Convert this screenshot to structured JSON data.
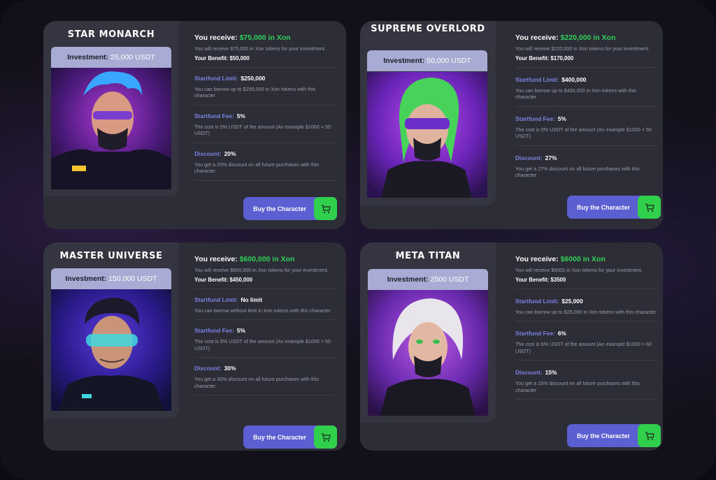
{
  "colors": {
    "accent_green": "#31d158",
    "label_purple": "#7b82df",
    "button_blue": "#5b5fd2",
    "invest_bg": "#a8acd4"
  },
  "common": {
    "receive_label": "You receive:",
    "benefit_label": "Your Benefit:",
    "limit_label": "Startfund Limit:",
    "fee_label": "Startfund Fee:",
    "discount_label": "Discount:",
    "invest_label": "Investment:",
    "buy_label": "Buy the Character",
    "buy_icon": "cart-icon"
  },
  "cards": [
    {
      "name": "STAR MONARCH",
      "investment": "25,000 USDT",
      "receive": "$75,000 in Xon",
      "receive_desc": "You will receive $75,000 in Xon tokens for your investment.",
      "benefit": "$50,000",
      "limit": "$250,000",
      "limit_desc": "You can borrow up to $250,000 in Xon tokens with this character",
      "fee": "5%",
      "fee_desc": "The cost is 5% USDT of the amount (An example $1000 = 50 USDT)",
      "discount": "20%",
      "discount_desc": "You get a 20% discount on all future purchases with this character"
    },
    {
      "name": "SUPREME OVERLORD",
      "investment": "50,000 USDT",
      "receive": "$220,000 in Xon",
      "receive_desc": "You will receive $220,000 in Xon tokens for your investment.",
      "benefit": "$170,000",
      "limit": "$400,000",
      "limit_desc": "You can borrow up to $400,000 in Xon tokens with this character",
      "fee": "5%",
      "fee_desc": "The cost is 5% USDT of the amount (An example $1000 = 50 USDT)",
      "discount": "27%",
      "discount_desc": "You get a 27% discount on all future purchases with this character"
    },
    {
      "name": "MASTER UNIVERSE",
      "investment": "150,000 USDT",
      "receive": "$600,000 in Xon",
      "receive_desc": "You will receive $600,000 in Xon tokens for your investment.",
      "benefit": "$450,000",
      "limit": "No limit",
      "limit_desc": "You can borrow without limit in Xon tokens with this character",
      "fee": "5%",
      "fee_desc": "The cost is 5% USDT of the amount (An example $1000 = 50 USDT)",
      "discount": "30%",
      "discount_desc": "You get a 30% discount on all future purchases with this character"
    },
    {
      "name": "META TITAN",
      "investment": "2500 USDT",
      "receive": "$6000 in Xon",
      "receive_desc": "You will receive $6000 in Xon tokens for your investment.",
      "benefit": "$3500",
      "limit": "$25,000",
      "limit_desc": "You can borrow up to $25,000 in Xon tokens with this character",
      "fee": "6%",
      "fee_desc": "The cost is 6% USDT of the amount (An example $1000 = 60 USDT)",
      "discount": "15%",
      "discount_desc": "You get a 15% discount on all future purchases with this character"
    }
  ]
}
